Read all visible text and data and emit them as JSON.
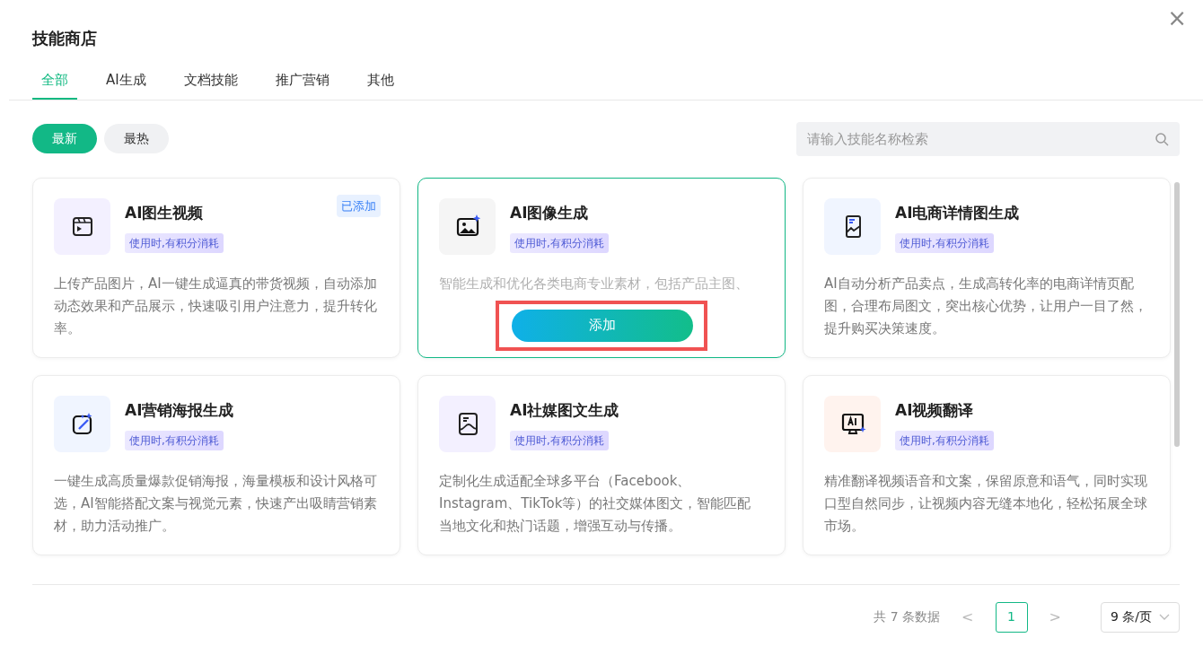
{
  "dialog": {
    "title": "技能商店",
    "close": "×"
  },
  "tabs": [
    {
      "label": "全部",
      "selected": true
    },
    {
      "label": "AI生成",
      "selected": false
    },
    {
      "label": "文档技能",
      "selected": false
    },
    {
      "label": "推广营销",
      "selected": false
    },
    {
      "label": "其他",
      "selected": false
    }
  ],
  "sort_filters": [
    {
      "label": "最新",
      "selected": true
    },
    {
      "label": "最热",
      "selected": false
    }
  ],
  "search": {
    "placeholder": "请输入技能名称检索"
  },
  "skills": [
    {
      "kind": "video",
      "title": "AI图生视频",
      "tag": "使用时,有积分消耗",
      "badge": "已添加",
      "hovered": false,
      "description": "上传产品图片，AI一键生成逼真的带货视频，自动添加动态效果和产品展示，快速吸引用户注意力，提升转化率。"
    },
    {
      "kind": "image",
      "title": "AI图像生成",
      "tag": "使用时,有积分消耗",
      "hovered": true,
      "description": "智能生成和优化各类电商专业素材，包括产品主图、",
      "action": "添加",
      "highlighted": true
    },
    {
      "kind": "detail",
      "title": "AI电商详情图生成",
      "tag": "使用时,有积分消耗",
      "hovered": false,
      "description": "AI自动分析产品卖点，生成高转化率的电商详情页配图，合理布局图文，突出核心优势，让用户一目了然，提升购买决策速度。"
    },
    {
      "kind": "poster",
      "title": "AI营销海报生成",
      "tag": "使用时,有积分消耗",
      "hovered": false,
      "description": "一键生成高质量爆款促销海报，海量模板和设计风格可选，AI智能搭配文案与视觉元素，快速产出吸睛营销素材，助力活动推广。"
    },
    {
      "kind": "social",
      "title": "AI社媒图文生成",
      "tag": "使用时,有积分消耗",
      "hovered": false,
      "description": "定制化生成适配全球多平台（Facebook、Instagram、TikTok等）的社交媒体图文，智能匹配当地文化和热门话题，增强互动与传播。"
    },
    {
      "kind": "translate",
      "title": "AI视频翻译",
      "tag": "使用时,有积分消耗",
      "hovered": false,
      "description": "精准翻译视频语音和文案，保留原意和语气，同时实现口型自然同步，让视频内容无缝本地化，轻松拓展全球市场。"
    }
  ],
  "pagination": {
    "total": "共 7 条数据",
    "prev": "<",
    "pages": [
      {
        "label": "1",
        "selected": true
      }
    ],
    "next": ">",
    "page_size": "9 条/页"
  }
}
